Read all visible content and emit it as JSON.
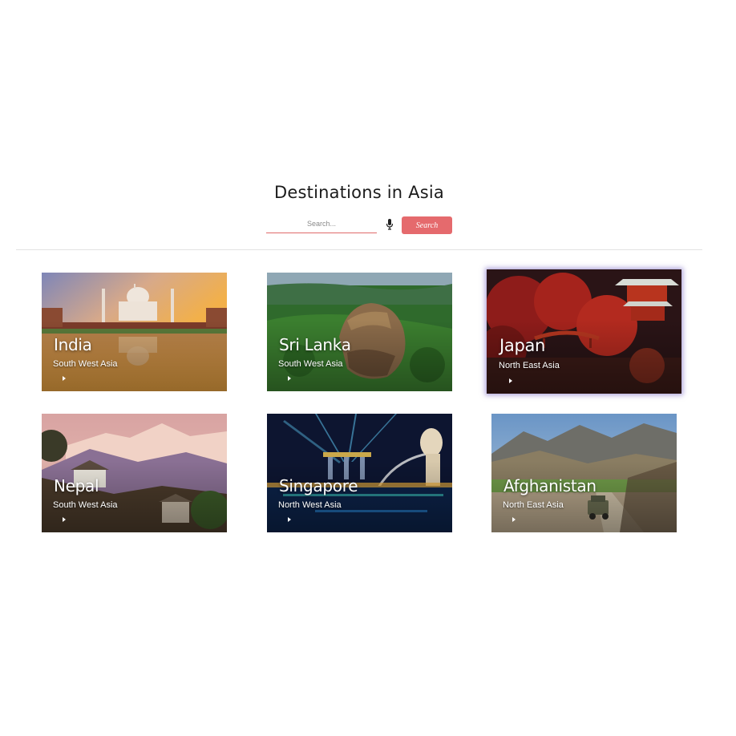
{
  "page": {
    "title": "Destinations in Asia"
  },
  "search": {
    "placeholder": "Search...",
    "button_label": "Search"
  },
  "colors": {
    "accent": "#e56a6d",
    "heading": "#1b1b1b"
  },
  "destinations": [
    {
      "name": "India",
      "region": "South West Asia",
      "icon": "play-icon"
    },
    {
      "name": "Sri Lanka",
      "region": "South West Asia",
      "icon": "play-icon"
    },
    {
      "name": "Japan",
      "region": "North East Asia",
      "icon": "play-icon"
    },
    {
      "name": "Nepal",
      "region": "South West Asia",
      "icon": "play-icon"
    },
    {
      "name": "Singapore",
      "region": "North West Asia",
      "icon": "play-icon"
    },
    {
      "name": "Afghanistan",
      "region": "North East Asia",
      "icon": "play-icon"
    }
  ]
}
